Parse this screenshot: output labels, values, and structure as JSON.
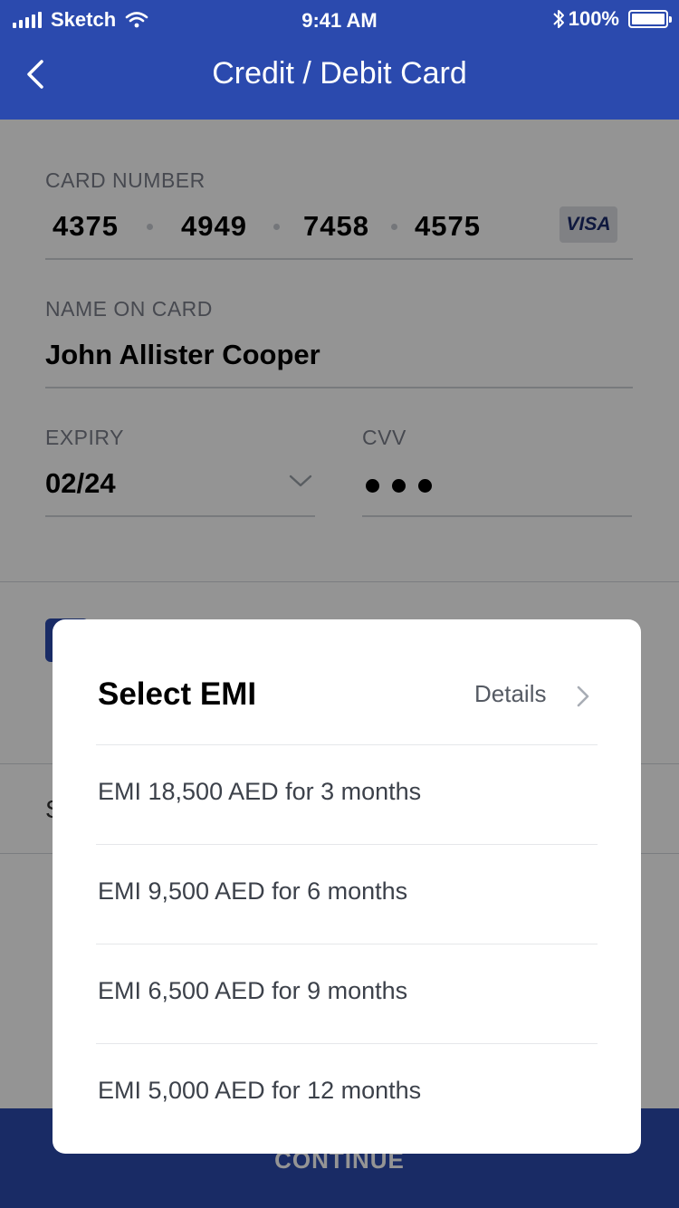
{
  "status_bar": {
    "carrier": "Sketch",
    "time": "9:41 AM",
    "battery": "100%"
  },
  "header": {
    "title": "Credit / Debit Card"
  },
  "form": {
    "card_number": {
      "label": "CARD NUMBER",
      "groups": [
        "4375",
        "4949",
        "7458",
        "4575"
      ],
      "brand": "VISA"
    },
    "name": {
      "label": "NAME ON CARD",
      "value": "John Allister Cooper"
    },
    "expiry": {
      "label": "EXPIRY",
      "value": "02/24"
    },
    "cvv": {
      "label": "CVV"
    }
  },
  "behind": {
    "partial_text": "S"
  },
  "footer": {
    "continue_label": "CONTINUE"
  },
  "dialog": {
    "title": "Select EMI",
    "details_label": "Details",
    "options": [
      "EMI 18,500 AED for 3 months",
      "EMI 9,500 AED for 6 months",
      "EMI 6,500 AED for 9 months",
      "EMI 5,000 AED for 12 months"
    ]
  },
  "colors": {
    "brand": "#2B4AAE",
    "overlay": "rgba(0,0,0,0.42)"
  }
}
